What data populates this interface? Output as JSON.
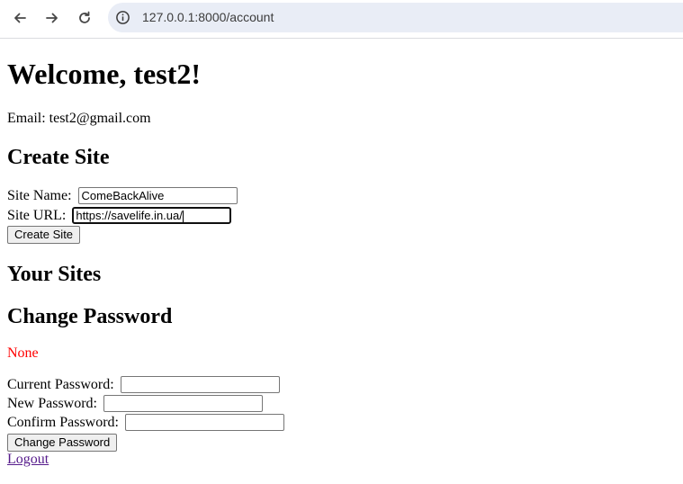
{
  "browser": {
    "url": "127.0.0.1:8000/account"
  },
  "page": {
    "welcome_heading": "Welcome, test2!",
    "email_label": "Email:",
    "email_value": "test2@gmail.com",
    "create_site_heading": "Create Site",
    "site_name_label": "Site Name:",
    "site_name_value": "ComeBackAlive",
    "site_url_label": "Site URL:",
    "site_url_value": "https://savelife.in.ua/",
    "create_site_button": "Create Site",
    "your_sites_heading": "Your Sites",
    "change_password_heading": "Change Password",
    "error_message": "None",
    "current_password_label": "Current Password:",
    "current_password_value": "",
    "new_password_label": "New Password:",
    "new_password_value": "",
    "confirm_password_label": "Confirm Password:",
    "confirm_password_value": "",
    "change_password_button": "Change Password",
    "logout_link": "Logout",
    "error_color": "#ff0000",
    "link_color": "#551a8b"
  }
}
